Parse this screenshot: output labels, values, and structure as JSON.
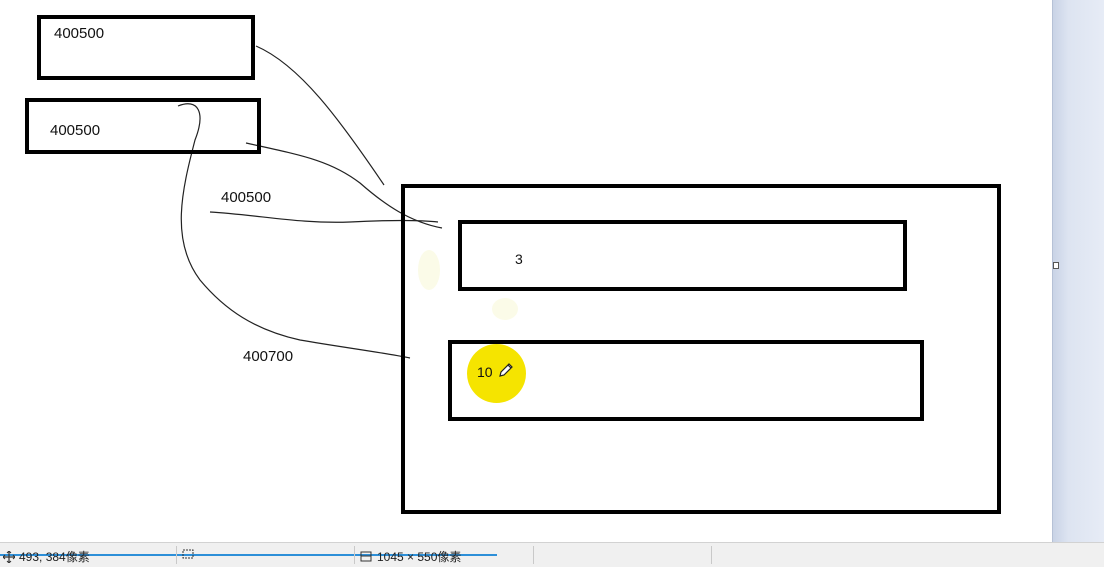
{
  "canvas": {
    "box_top": "400500",
    "box_second": "400500",
    "loose_label_a": "400500",
    "loose_label_b": "400700",
    "inner_box_upper": "3",
    "inner_box_lower": "10"
  },
  "statusbar": {
    "cursor_position": "493, 384像素",
    "image_size": "1045 × 550像素"
  },
  "icons": {
    "pointer": "move-cursor-icon",
    "selection": "selection-icon",
    "size": "image-size-icon",
    "pencil": "pencil-icon"
  },
  "colors": {
    "highlight": "#f5e400",
    "progress": "#2d8fd8"
  }
}
